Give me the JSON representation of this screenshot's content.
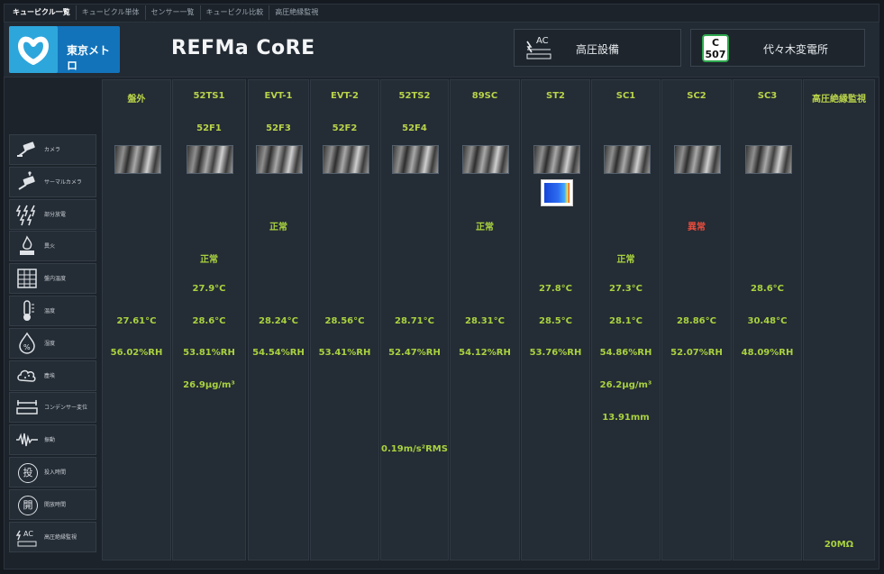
{
  "tabs": [
    "キュービクル一覧",
    "キュービクル単体",
    "センサー一覧",
    "キュービクル比較",
    "高圧絶縁監視"
  ],
  "brand": {
    "logo_text": "東京メトロ"
  },
  "app_title": "REFMa CoRE",
  "equipment": {
    "label": "高圧設備",
    "icon": "ac-transformer-icon",
    "icon_text": "AC"
  },
  "station": {
    "code_top": "C",
    "code_num": "507",
    "name": "代々木変電所"
  },
  "sensor_rows": [
    {
      "label": "カメラ",
      "icon": "camera-icon"
    },
    {
      "label": "サーマルカメラ",
      "icon": "thermal-camera-icon"
    },
    {
      "label": "部分放電",
      "icon": "partial-discharge-icon"
    },
    {
      "label": "異火",
      "icon": "fire-icon"
    },
    {
      "label": "盤内温度",
      "icon": "panel-temperature-icon"
    },
    {
      "label": "温度",
      "icon": "thermometer-icon"
    },
    {
      "label": "湿度",
      "icon": "humidity-icon"
    },
    {
      "label": "塵埃",
      "icon": "dust-icon"
    },
    {
      "label": "コンデンサー変位",
      "icon": "capacitor-displacement-icon"
    },
    {
      "label": "振動",
      "icon": "vibration-icon"
    },
    {
      "label": "投入時間",
      "icon": "close-time-icon",
      "icon_text": "投"
    },
    {
      "label": "開放時間",
      "icon": "open-time-icon",
      "icon_text": "開"
    },
    {
      "label": "高圧絶縁監視",
      "icon": "insulation-monitor-icon",
      "icon_text": "AC"
    }
  ],
  "columns": [
    {
      "name": "盤外",
      "sub": "",
      "camera": true,
      "thermal": false,
      "partial_discharge": "",
      "arc": "",
      "panel_temp": "",
      "temp": "27.61°C",
      "humidity": "56.02%RH",
      "dust": "",
      "displacement": "",
      "vibration": "",
      "insulation": ""
    },
    {
      "name": "52TS1",
      "sub": "52F1",
      "camera": true,
      "thermal": false,
      "partial_discharge": "",
      "arc": "正常",
      "panel_temp": "27.9°C",
      "temp": "28.6°C",
      "humidity": "53.81%RH",
      "dust": "26.9μg/m³",
      "displacement": "",
      "vibration": "",
      "insulation": ""
    },
    {
      "name": "EVT-1",
      "sub": "52F3",
      "camera": true,
      "thermal": false,
      "partial_discharge": "正常",
      "arc": "",
      "panel_temp": "",
      "temp": "28.24°C",
      "humidity": "54.54%RH",
      "dust": "",
      "displacement": "",
      "vibration": "",
      "insulation": ""
    },
    {
      "name": "EVT-2",
      "sub": "52F2",
      "camera": true,
      "thermal": false,
      "partial_discharge": "",
      "arc": "",
      "panel_temp": "",
      "temp": "28.56°C",
      "humidity": "53.41%RH",
      "dust": "",
      "displacement": "",
      "vibration": "",
      "insulation": ""
    },
    {
      "name": "52TS2",
      "sub": "52F4",
      "camera": true,
      "thermal": false,
      "partial_discharge": "",
      "arc": "",
      "panel_temp": "",
      "temp": "28.71°C",
      "humidity": "52.47%RH",
      "dust": "",
      "displacement": "",
      "vibration": "0.19m/s²RMS",
      "insulation": ""
    },
    {
      "name": "89SC",
      "sub": "",
      "camera": true,
      "thermal": false,
      "partial_discharge": "正常",
      "arc": "",
      "panel_temp": "",
      "temp": "28.31°C",
      "humidity": "54.12%RH",
      "dust": "",
      "displacement": "",
      "vibration": "",
      "insulation": ""
    },
    {
      "name": "ST2",
      "sub": "",
      "camera": true,
      "thermal": true,
      "partial_discharge": "",
      "arc": "",
      "panel_temp": "27.8°C",
      "temp": "28.5°C",
      "humidity": "53.76%RH",
      "dust": "",
      "displacement": "",
      "vibration": "",
      "insulation": ""
    },
    {
      "name": "SC1",
      "sub": "",
      "camera": true,
      "thermal": false,
      "partial_discharge": "",
      "arc": "正常",
      "panel_temp": "27.3°C",
      "temp": "28.1°C",
      "humidity": "54.86%RH",
      "dust": "26.2μg/m³",
      "displacement": "13.91mm",
      "vibration": "",
      "insulation": ""
    },
    {
      "name": "SC2",
      "sub": "",
      "camera": true,
      "thermal": false,
      "partial_discharge": "異常",
      "arc": "",
      "panel_temp": "",
      "temp": "28.86°C",
      "humidity": "52.07%RH",
      "dust": "",
      "displacement": "",
      "vibration": "",
      "insulation": ""
    },
    {
      "name": "SC3",
      "sub": "",
      "camera": true,
      "thermal": false,
      "partial_discharge": "",
      "arc": "",
      "panel_temp": "28.6°C",
      "temp": "30.48°C",
      "humidity": "48.09%RH",
      "dust": "",
      "displacement": "",
      "vibration": "",
      "insulation": ""
    },
    {
      "name": "高圧絶縁監視",
      "sub": "",
      "camera": false,
      "thermal": false,
      "partial_discharge": "",
      "arc": "",
      "panel_temp": "",
      "temp": "",
      "humidity": "",
      "dust": "",
      "displacement": "",
      "vibration": "",
      "insulation": "20MΩ"
    }
  ],
  "colors": {
    "value": "#a9d23f",
    "alarm": "#e84c3d",
    "header": "#b9d34a",
    "panel": "#242c35"
  }
}
